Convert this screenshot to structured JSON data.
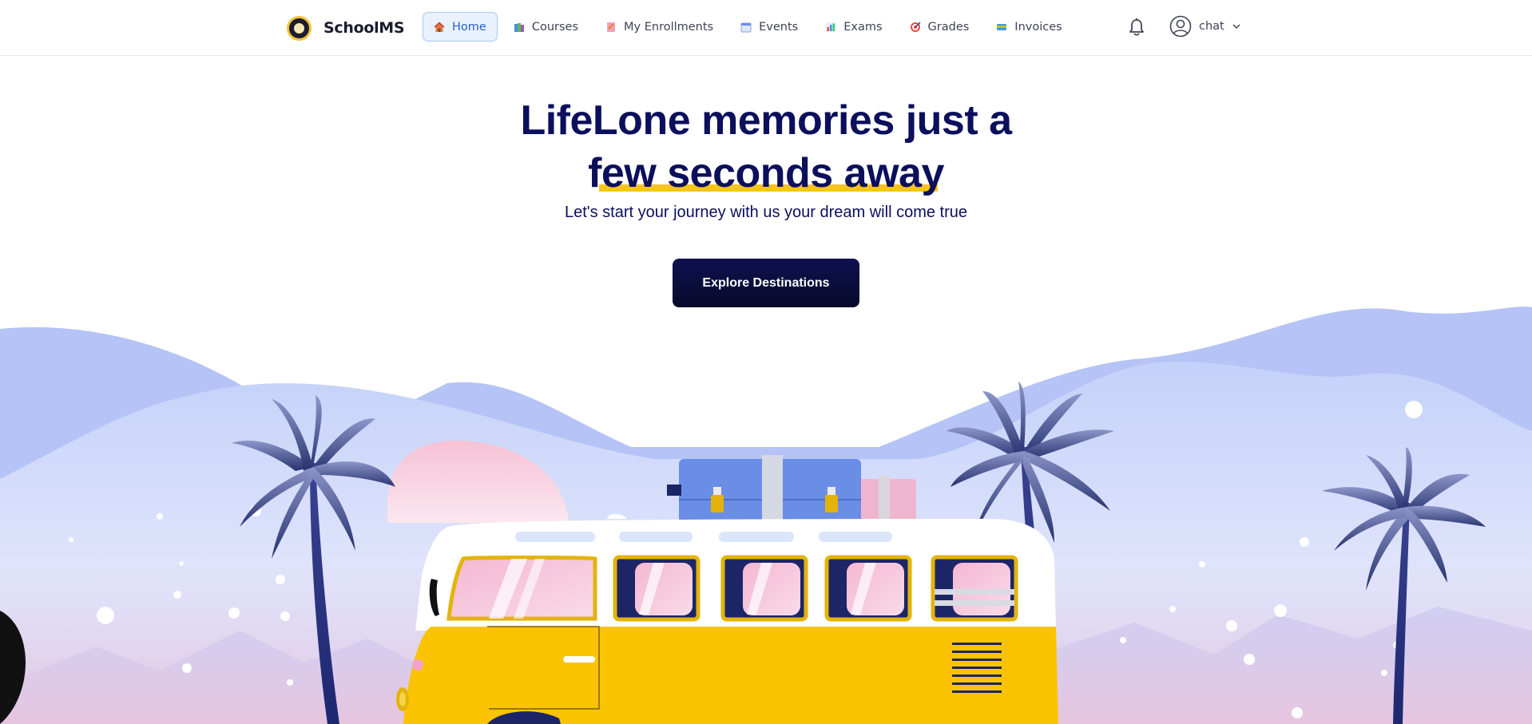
{
  "brand": {
    "name": "SchoolMS"
  },
  "nav": {
    "items": [
      {
        "label": "Home",
        "icon": "house-icon",
        "active": true
      },
      {
        "label": "Courses",
        "icon": "books-icon"
      },
      {
        "label": "My Enrollments",
        "icon": "notebook-icon"
      },
      {
        "label": "Events",
        "icon": "calendar-icon"
      },
      {
        "label": "Exams",
        "icon": "chart-icon"
      },
      {
        "label": "Grades",
        "icon": "target-icon"
      },
      {
        "label": "Invoices",
        "icon": "card-icon"
      }
    ]
  },
  "header": {
    "notifications_icon": "bell-icon",
    "user": {
      "name": "chat",
      "icon": "user-avatar-icon"
    }
  },
  "hero": {
    "title_line1": "LifeLone memories just a",
    "title_line2": "few seconds away",
    "subtitle": "Let's start your journey with us your dream will come true",
    "cta_label": "Explore Destinations"
  },
  "colors": {
    "title": "#0b0f5c",
    "highlight": "#f5c518",
    "active_nav_bg": "#e9f1fd",
    "active_nav_text": "#2a5fd0",
    "cta_bg": "#0b0d3d",
    "van_yellow": "#fbc402",
    "sky": "#b7c6f5"
  }
}
